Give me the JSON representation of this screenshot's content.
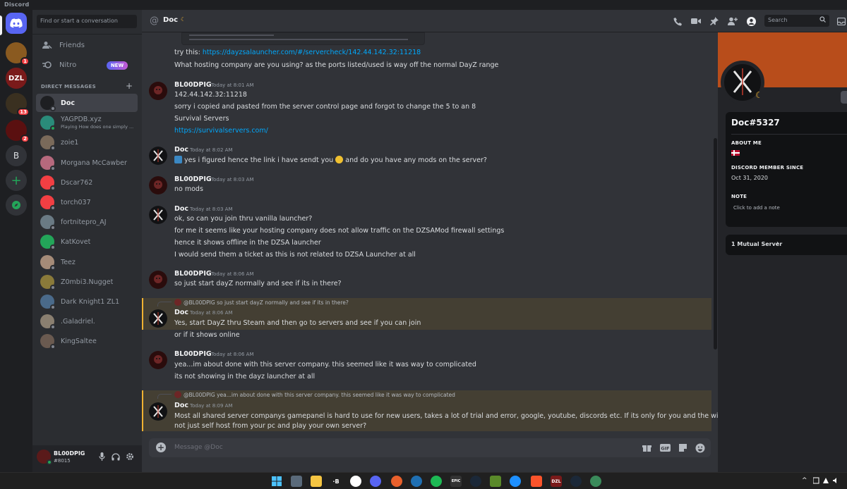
{
  "window": {
    "title": "Discord"
  },
  "rail": {
    "servers": [
      {
        "name": "home",
        "badge": ""
      },
      {
        "name": "server-1",
        "badge": "1"
      },
      {
        "name": "server-dzl",
        "label": "DZL",
        "badge": ""
      },
      {
        "name": "server-3",
        "badge": "13"
      },
      {
        "name": "server-4",
        "badge": "2"
      },
      {
        "name": "server-b",
        "label": "B",
        "badge": ""
      }
    ]
  },
  "sidebar": {
    "search_placeholder": "Find or start a conversation",
    "friends_label": "Friends",
    "nitro_label": "Nitro",
    "nitro_badge": "NEW",
    "dm_header": "DIRECT MESSAGES",
    "dms": [
      {
        "name": "Doc",
        "sub": "",
        "color": "#1e1f22",
        "online": false,
        "active": true
      },
      {
        "name": "YAGPDB.xyz",
        "sub": "Playing How does one simply ...",
        "color": "#2a8b7a",
        "online": true,
        "active": false
      },
      {
        "name": "zoie1",
        "sub": "",
        "color": "#7a6a5a",
        "online": false,
        "active": false
      },
      {
        "name": "Morgana McCawber",
        "sub": "",
        "color": "#b6697d",
        "online": false,
        "active": false
      },
      {
        "name": "Dscar762",
        "sub": "",
        "color": "#f23f43",
        "online": false,
        "active": false
      },
      {
        "name": "torch037",
        "sub": "",
        "color": "#f23f43",
        "online": false,
        "active": false
      },
      {
        "name": "fortnitepro_AJ",
        "sub": "",
        "color": "#6a7a84",
        "online": false,
        "active": false
      },
      {
        "name": "KatKovet",
        "sub": "",
        "color": "#23a559",
        "online": false,
        "active": false
      },
      {
        "name": "Teez",
        "sub": "",
        "color": "#a58b78",
        "online": false,
        "active": false
      },
      {
        "name": "Z0mbi3.Nugget",
        "sub": "",
        "color": "#8a7a3a",
        "online": false,
        "active": false
      },
      {
        "name": "Dark Knight1 ZL1",
        "sub": "",
        "color": "#4a6a8a",
        "online": false,
        "active": false
      },
      {
        "name": ".Galadriel.",
        "sub": "",
        "color": "#8a7f70",
        "online": false,
        "active": false
      },
      {
        "name": "KingSaltee",
        "sub": "",
        "color": "#6a5a50",
        "online": false,
        "active": false
      }
    ]
  },
  "user_panel": {
    "name": "BL00DPIG",
    "tag": "#8015"
  },
  "header": {
    "channel_name": "Doc",
    "search_placeholder": "Search"
  },
  "messages": {
    "top_lines": [
      {
        "text_prefix": "try this: ",
        "link": "https://dayzsalauncher.com/#/servercheck/142.44.142.32:11218"
      },
      {
        "text": "What hosting company are you using? as the ports listed/used is way off the normal DayZ range"
      }
    ],
    "groups": [
      {
        "author": "BL00DPIG",
        "time": "Today at 8:01 AM",
        "lines": [
          "142.44.142.32:11218",
          "sorry i copied and pasted from the server control page and forgot to change the 5 to an 8",
          "Survival Servers"
        ],
        "link": "https://survivalservers.com/"
      },
      {
        "author": "Doc",
        "time": "Today at 8:02 AM",
        "lines": [
          "yes i figured hence the link i have sendt you",
          "and do you have any mods on the server?"
        ]
      },
      {
        "author": "BL00DPIG",
        "time": "Today at 8:03 AM",
        "lines": [
          "no mods"
        ]
      },
      {
        "author": "Doc",
        "time": "Today at 8:03 AM",
        "lines": [
          "ok, so can you join thru vanilla launcher?",
          "for me it seems like your hosting company does not allow traffic on the DZSAMod firewall settings",
          "hence it shows offline in the DZSA launcher",
          "I would send them a ticket as this is not related to DZSA Launcher at all"
        ]
      },
      {
        "author": "BL00DPIG",
        "time": "Today at 8:06 AM",
        "lines": [
          "so just start dayZ normally and see if its in there?"
        ]
      },
      {
        "reply_to": "@BL00DPIG so just start dayZ normally and see if its in there?",
        "author": "Doc",
        "time": "Today at 8:06 AM",
        "lines": [
          "Yes, start DayZ thru Steam and then go to servers and see if you can join",
          "or if it shows online"
        ]
      },
      {
        "author": "BL00DPIG",
        "time": "Today at 8:06 AM",
        "lines": [
          "yea...im about done with this server company. this seemed like it was way to complicated",
          "its not showing in the dayz launcher at all"
        ]
      },
      {
        "reply_to": "@BL00DPIG yea...im about done with this server company. this seemed like it was way to complicated",
        "author": "Doc",
        "time": "Today at 8:09 AM",
        "lines": [
          "Most all shared server companys gamepanel is hard to use for new users, takes a lot of trial and error, google, youtube, discords etc. If its only for you and the wife why",
          "not just self host from your pc and play your own server?"
        ]
      }
    ]
  },
  "composer": {
    "placeholder": "Message @Doc"
  },
  "profile": {
    "name": "Doc#5327",
    "about_label": "ABOUT ME",
    "member_since_label": "DISCORD MEMBER SINCE",
    "member_since": "Oct 31, 2020",
    "note_label": "NOTE",
    "note_placeholder": "Click to add a note",
    "mutual": "1 Mutual Server",
    "banner_color": "#b84d1b"
  },
  "colors": {
    "accent": "#5865f2",
    "link": "#00a8fc",
    "mention_bg": "#443f33",
    "mention_bar": "#f0b232"
  }
}
